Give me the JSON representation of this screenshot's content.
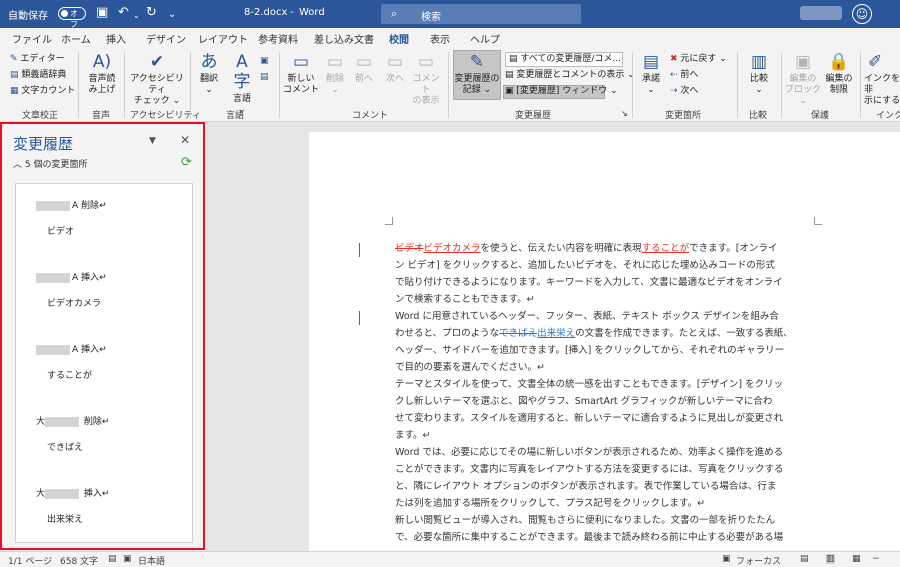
{
  "titlebar": {
    "autosave": "自動保存",
    "toggle_state": "オフ",
    "filename": "8-2.docx",
    "separator": "-",
    "app": "Word",
    "search_placeholder": "検索"
  },
  "tabs": [
    "ファイル",
    "ホーム",
    "挿入",
    "デザイン",
    "レイアウト",
    "参考資料",
    "差し込み文書",
    "校閲",
    "表示",
    "ヘルプ"
  ],
  "active_tab": "校閲",
  "ribbon": {
    "proofing": {
      "editor": "エディター",
      "thesaurus": "類義語辞典",
      "wordcount": "文字カウント",
      "group": "文章校正"
    },
    "speech": {
      "read_aloud_1": "音声読",
      "read_aloud_2": "み上げ",
      "group": "音声"
    },
    "accessibility": {
      "check_1": "アクセシビリティ",
      "check_2": "チェック ⌄",
      "group": "アクセシビリティ"
    },
    "language": {
      "translate": "翻訳",
      "language": "言語",
      "group": "言語"
    },
    "comments": {
      "new_1": "新しい",
      "new_2": "コメント",
      "delete": "削除",
      "prev": "前へ",
      "next": "次へ",
      "show_1": "コメント",
      "show_2": "の表示",
      "group": "コメント"
    },
    "tracking": {
      "track_1": "変更履歴の",
      "track_2": "記録 ⌄",
      "markup_select": "すべての変更履歴/コメ...",
      "show_markup": "変更履歴とコメントの表示 ⌄",
      "pane": "[変更履歴] ウィンドウ ⌄",
      "group": "変更履歴"
    },
    "changes": {
      "accept": "承諾",
      "reject": "元に戻す",
      "prev": "前へ",
      "next": "次へ",
      "group": "変更箇所"
    },
    "compare": {
      "label": "比較",
      "group": "比較"
    },
    "protect": {
      "block_1": "編集の",
      "block_2": "ブロック ⌄",
      "restrict_1": "編集の",
      "restrict_2": "制限",
      "group": "保護"
    },
    "ink": {
      "hide_1": "インクを非",
      "hide_2": "示にする",
      "group": "インク"
    }
  },
  "pane": {
    "title": "変更履歴",
    "count": "5 個の変更箇所",
    "revisions": [
      {
        "author_suffix": "A",
        "action": "削除",
        "text": "ビデオ"
      },
      {
        "author_suffix": "A",
        "action": "挿入",
        "text": "ビデオカメラ"
      },
      {
        "author_suffix": "A",
        "action": "挿入",
        "text": "することが"
      },
      {
        "author_prefix": "大",
        "action": "削除",
        "text": "できばえ"
      },
      {
        "author_prefix": "大",
        "action": "挿入",
        "text": "出来栄え"
      }
    ]
  },
  "doc": {
    "p1_del": "ビデオ",
    "p1_ins": "ビデオカメラ",
    "p1_a": "を使うと、伝えたい内容を明確に表現",
    "p1_ins2": "することが",
    "p1_b": "できます。[オンライ",
    "l2": "ン ビデオ] をクリックすると、追加したいビデオを、それに応じた埋め込みコードの形式",
    "l3": "で貼り付けできるようになります。キーワードを入力して、文書に最適なビデオをオンライ",
    "l4": "ンで検索することもできます。↵",
    "l5": "Word に用意されているヘッダー、フッター、表紙、テキスト ボックス デザインを組み合",
    "l6a": "わせると、プロのような",
    "l6_del": "できばえ",
    "l6_ins": "出来栄え",
    "l6b": "の文書を作成できます。たとえば、一致する表紙、",
    "l7": "ヘッダー、サイドバーを追加できます。[挿入] をクリックしてから、それぞれのギャラリー",
    "l8": "で目的の要素を選んでください。↵",
    "l9": "テーマとスタイルを使って、文書全体の統一感を出すこともできます。[デザイン] をクリッ",
    "l10": "クし新しいテーマを選ぶと、図やグラフ、SmartArt グラフィックが新しいテーマに合わ",
    "l11": "せて変わります。スタイルを適用すると、新しいテーマに適合するように見出しが変更され",
    "l12": "ます。↵",
    "l13": "Word では、必要に応じてその場に新しいボタンが表示されるため、効率よく操作を進める",
    "l14": "ことができます。文書内に写真をレイアウトする方法を変更するには、写真をクリックする",
    "l15": "と、隣にレイアウト オプションのボタンが表示されます。表で作業している場合は、行ま",
    "l16": "たは列を追加する場所をクリックして、プラス記号をクリックします。↵",
    "l17": "新しい閲覧ビューが導入され、閲覧もさらに便利になりました。文書の一部を折りたたん",
    "l18": "で、必要な箇所に集中することができます。最後まで読み終わる前に中止する必要がある場"
  },
  "status": {
    "page": "1/1 ページ",
    "words": "658 文字",
    "lang": "日本語",
    "focus": "フォーカス"
  }
}
